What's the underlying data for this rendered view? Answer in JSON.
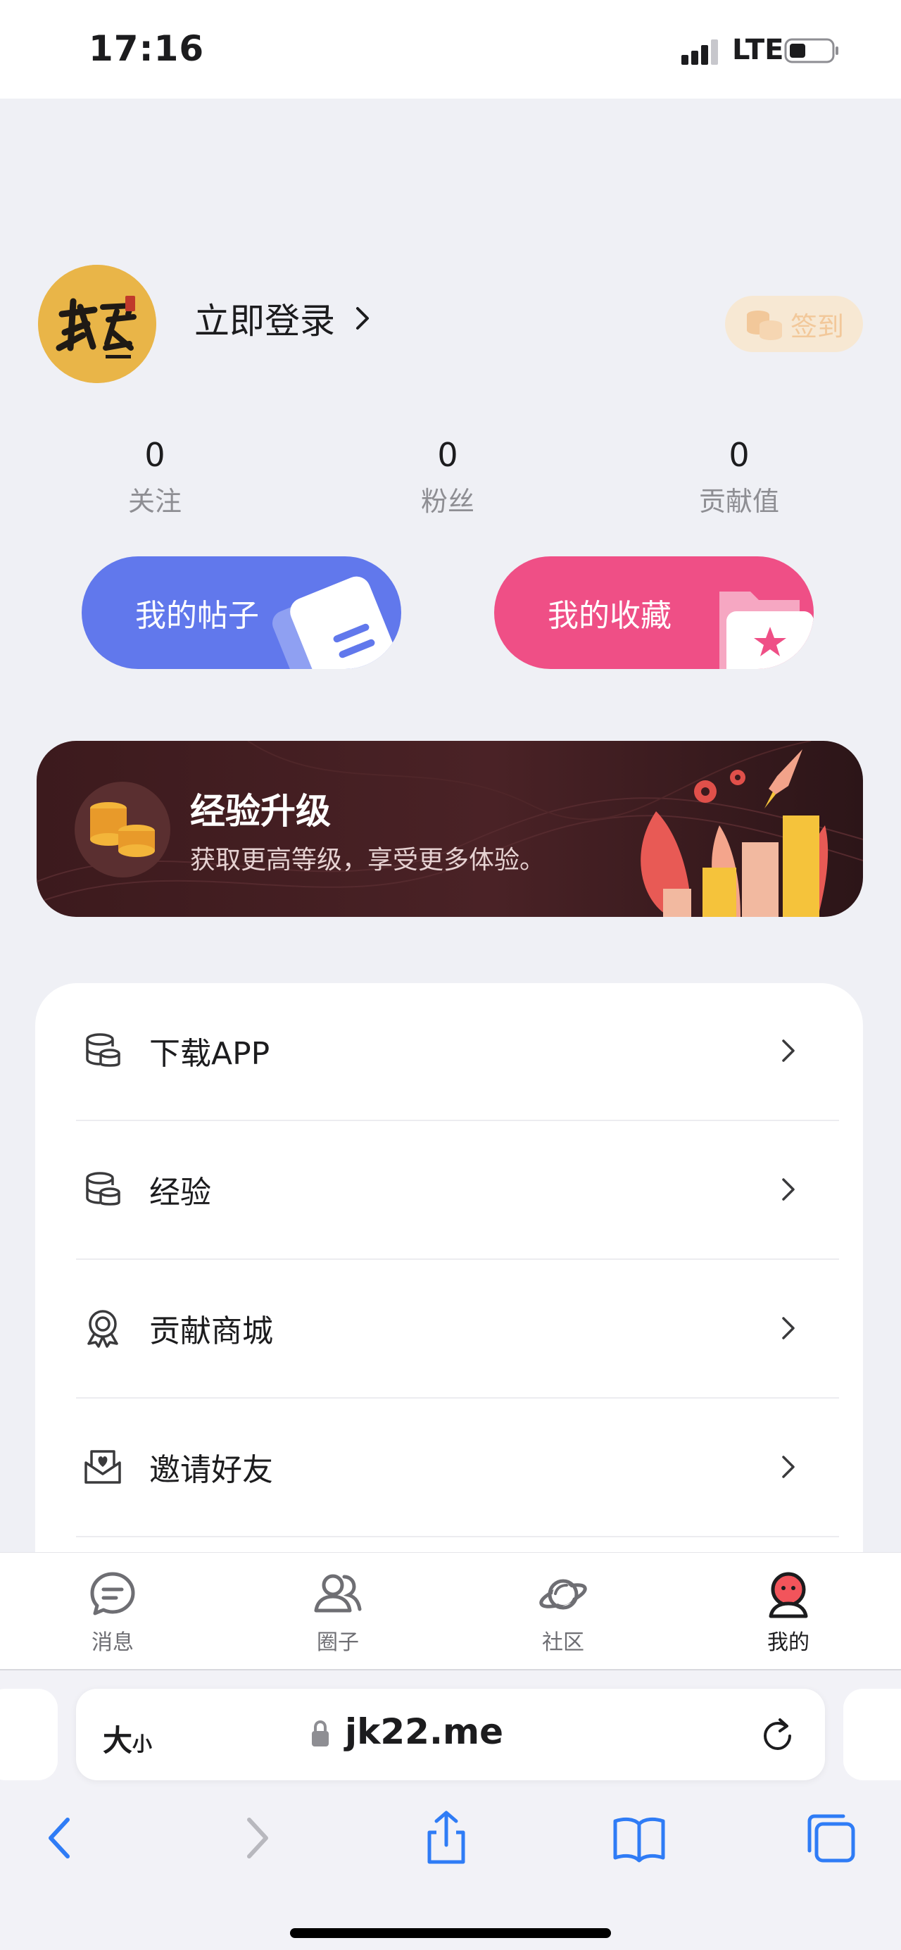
{
  "status_bar": {
    "time": "17:16",
    "network": "LTE"
  },
  "profile": {
    "login_label": "立即登录",
    "signin_label": "签到",
    "stats": [
      {
        "value": "0",
        "label": "关注"
      },
      {
        "value": "0",
        "label": "粉丝"
      },
      {
        "value": "0",
        "label": "贡献值"
      }
    ]
  },
  "actions": {
    "posts_label": "我的帖子",
    "favorites_label": "我的收藏"
  },
  "banner": {
    "title": "经验升级",
    "subtitle": "获取更高等级，享受更多体验。"
  },
  "menu": {
    "items": [
      {
        "label": "下载APP",
        "icon": "database-icon"
      },
      {
        "label": "经验",
        "icon": "database-icon"
      },
      {
        "label": "贡献商城",
        "icon": "award-badge-icon"
      },
      {
        "label": "邀请好友",
        "icon": "mail-heart-icon"
      }
    ]
  },
  "tabbar": {
    "tabs": [
      {
        "label": "消息",
        "icon": "chat-bubble-icon",
        "active": false
      },
      {
        "label": "圈子",
        "icon": "users-icon",
        "active": false
      },
      {
        "label": "社区",
        "icon": "planet-icon",
        "active": false
      },
      {
        "label": "我的",
        "icon": "profile-face-icon",
        "active": true
      }
    ]
  },
  "browser": {
    "text_size_big": "大",
    "text_size_small": "小",
    "url": "jk22.me"
  },
  "colors": {
    "background": "#eff0f5",
    "posts_card": "#6178ec",
    "favorites_card": "#ef4f86",
    "avatar_gold": "#e9b548",
    "banner_dark": "#3c1a1d",
    "ios_blue": "#2f7cf6"
  }
}
